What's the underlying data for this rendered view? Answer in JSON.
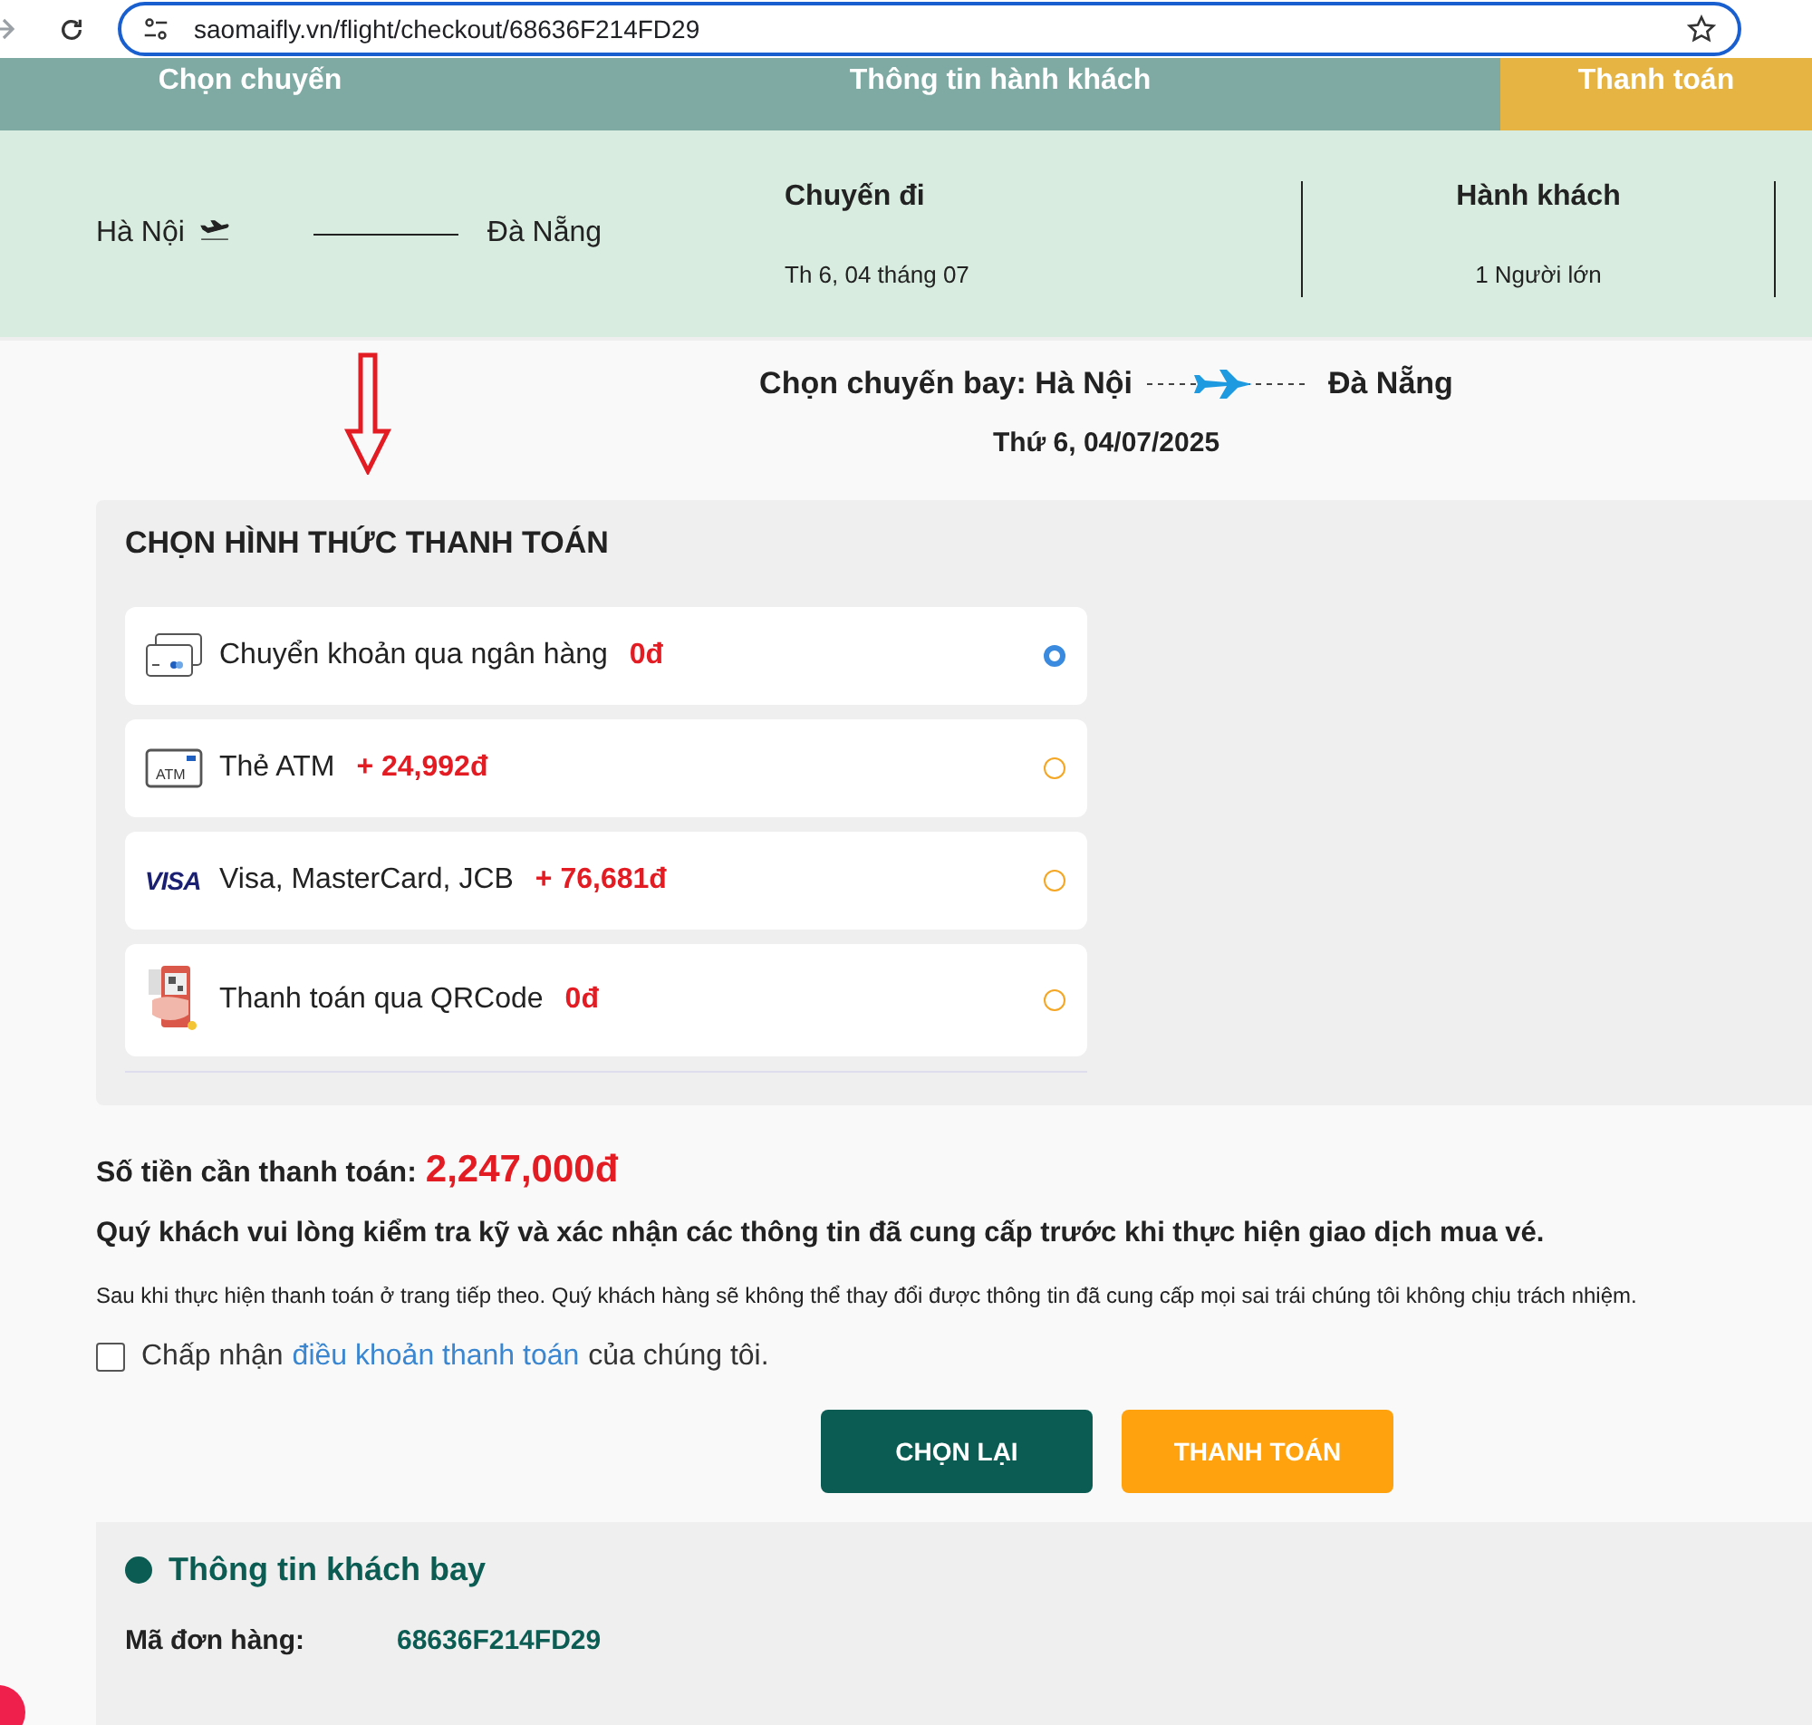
{
  "browser": {
    "url": "saomaifly.vn/flight/checkout/68636F214FD29"
  },
  "steps": [
    {
      "label": "Chọn chuyến",
      "selected": false
    },
    {
      "label": "Thông tin hành khách",
      "selected": false
    },
    {
      "label": "Thanh toán",
      "selected": true
    }
  ],
  "trip_summary": {
    "origin": "Hà Nội",
    "destination": "Đà Nẵng",
    "trip_label": "Chuyến đi",
    "trip_date": "Th 6, 04 tháng 07",
    "passengers_label": "Hành khách",
    "passengers": "1 Người lớn"
  },
  "flight_heading": {
    "prefix": "Chọn chuyến bay: Hà Nội",
    "destination": "Đà Nẵng",
    "date": "Thứ 6, 04/07/2025"
  },
  "payment": {
    "title": "CHỌN HÌNH THỨC THANH TOÁN",
    "methods": [
      {
        "kind": "bank",
        "label": "Chuyển khoản qua ngân hàng",
        "fee": "0đ",
        "selected": true
      },
      {
        "kind": "atm",
        "icon_text": "ATM",
        "label": "Thẻ ATM",
        "fee": "+ 24,992đ",
        "selected": false
      },
      {
        "kind": "visa",
        "icon_text": "VISA",
        "label": "Visa, MasterCard, JCB",
        "fee": "+ 76,681đ",
        "selected": false
      },
      {
        "kind": "qr",
        "label": "Thanh toán qua QRCode",
        "fee": "0đ",
        "selected": false
      }
    ]
  },
  "total": {
    "label": "Số tiền cần thanh toán:",
    "amount": "2,247,000đ"
  },
  "notice": "Quý khách vui lòng kiểm tra kỹ và xác nhận các thông tin đã cung cấp trước khi thực hiện giao dịch mua vé.",
  "disclaimer": "Sau khi thực hiện thanh toán ở trang tiếp theo. Quý khách hàng sẽ không thể thay đổi được thông tin đã cung cấp mọi sai trái chúng tôi không chịu trách nhiệm.",
  "terms": {
    "checked": false,
    "before": "Chấp nhận",
    "link": "điều khoản thanh toán",
    "after": "của chúng tôi."
  },
  "buttons": [
    {
      "kind": "secondary",
      "label": "CHỌN LẠI"
    },
    {
      "kind": "primary",
      "label": "THANH TOÁN"
    }
  ],
  "passenger_info": {
    "title": "Thông tin khách bay",
    "order_label": "Mã đơn hàng:",
    "order_code": "68636F214FD29"
  }
}
